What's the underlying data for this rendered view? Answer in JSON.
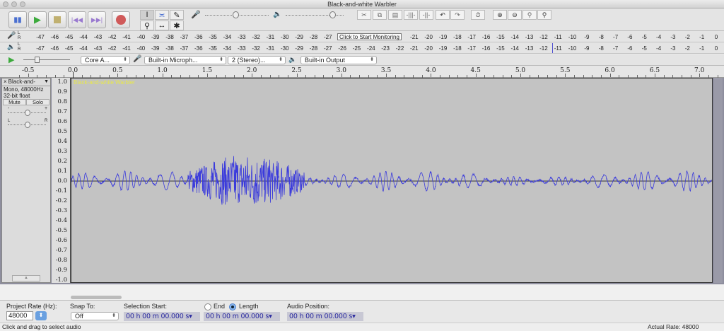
{
  "window": {
    "title": "Black-and-white Warbler"
  },
  "transport": {
    "buttons": [
      "pause",
      "play",
      "stop",
      "skip-to-start",
      "skip-to-end",
      "record"
    ]
  },
  "tools": {
    "items": [
      "selection-tool",
      "envelope-tool",
      "draw-tool",
      "zoom-tool",
      "time-shift-tool",
      "multi-tool"
    ]
  },
  "meters": {
    "record_ticks": [
      "-47",
      "-46",
      "-45",
      "-44",
      "-43",
      "-42",
      "-41",
      "-40",
      "-39",
      "-38",
      "-37",
      "-36",
      "-35",
      "-34",
      "-33",
      "-32",
      "-31",
      "-30",
      "-29",
      "-28",
      "-27",
      "-26",
      "-25",
      "-24",
      "-23",
      "-22",
      "-21",
      "-20",
      "-19",
      "-18",
      "-17",
      "-16",
      "-15",
      "-14",
      "-13",
      "-12",
      "-11",
      "-10",
      "-9",
      "-8",
      "-7",
      "-6",
      "-5",
      "-4",
      "-3",
      "-2",
      "-1",
      "0"
    ],
    "monitor_label": "Click to Start Monitoring",
    "channel_l": "L",
    "channel_r": "R"
  },
  "device": {
    "host": "Core A...",
    "input": "Built-in Microph...",
    "channels": "2 (Stereo)...",
    "output": "Built-in Output"
  },
  "ruler": {
    "labels": [
      "-0.5",
      "0.0",
      "0.5",
      "1.0",
      "1.5",
      "2.0",
      "2.5",
      "3.0",
      "3.5",
      "4.0",
      "4.5",
      "5.0",
      "5.5",
      "6.0",
      "6.5",
      "7.0"
    ]
  },
  "track": {
    "name": "Black-and-",
    "info1": "Mono, 48000Hz",
    "info2": "32-bit float",
    "mute": "Mute",
    "solo": "Solo",
    "gain_minus": "-",
    "gain_plus": "+",
    "pan_l": "L",
    "pan_r": "R",
    "clip_name": "Black-and-white Warbler",
    "clip_name_color": "#e8e84a",
    "waveform_color": "#3b3bdc",
    "vruler": [
      "1.0",
      "0.9",
      "0.8",
      "0.7",
      "0.6",
      "0.5",
      "0.4",
      "0.3",
      "0.2",
      "0.1",
      "0.0",
      "-0.1",
      "-0.2",
      "-0.3",
      "-0.4",
      "-0.5",
      "-0.6",
      "-0.7",
      "-0.8",
      "-0.9",
      "-1.0"
    ]
  },
  "selection_bar": {
    "project_rate_label": "Project Rate (Hz):",
    "project_rate": "48000",
    "snap_label": "Snap To:",
    "snap_value": "Off",
    "sel_start_label": "Selection Start:",
    "end_label": "End",
    "length_label": "Length",
    "length_selected": true,
    "audio_pos_label": "Audio Position:",
    "sel_start": "00 h 00 m 00.000 s",
    "sel_length": "00 h 00 m 00.000 s",
    "audio_pos": "00 h 00 m 00.000 s"
  },
  "status": {
    "message": "Click and drag to select audio",
    "rate": "Actual Rate: 48000"
  }
}
